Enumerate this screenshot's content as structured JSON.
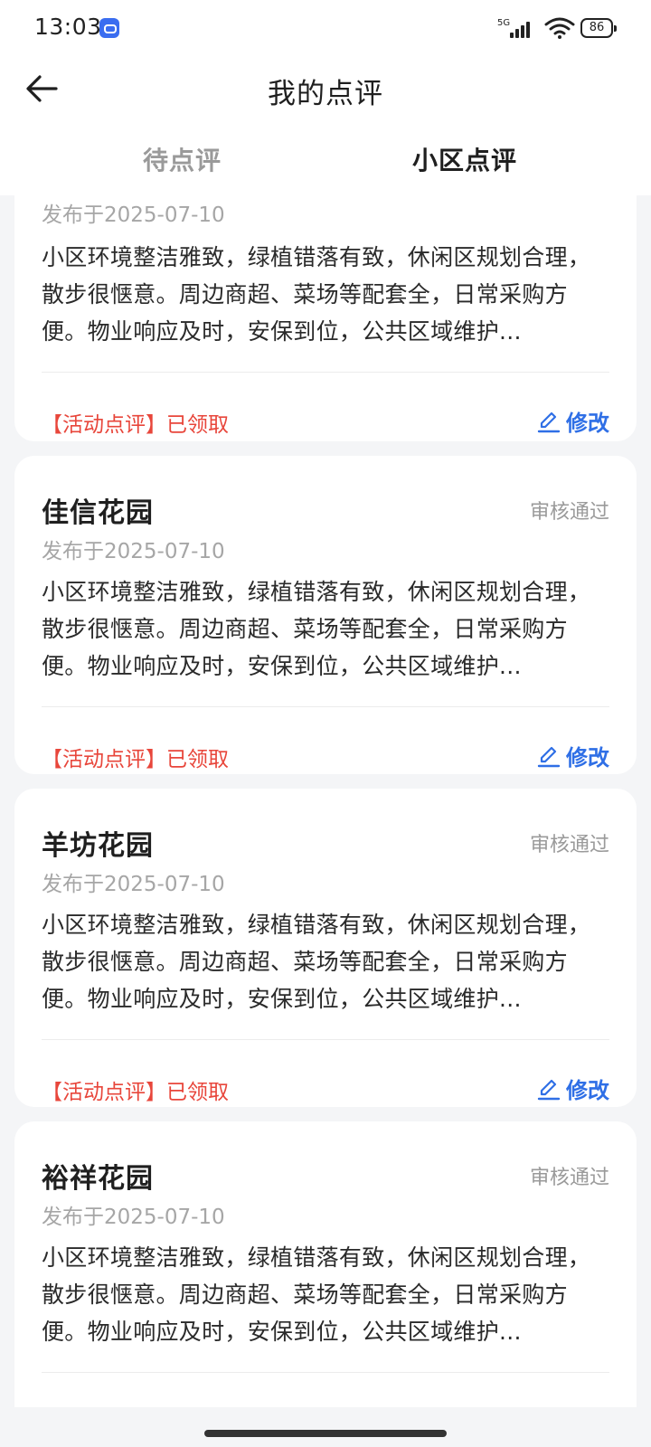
{
  "status_bar": {
    "time": "13:03",
    "network": "5G",
    "battery": "86"
  },
  "header": {
    "title": "我的点评",
    "back_icon": "arrow-left-icon"
  },
  "tabs": [
    {
      "label": "待点评",
      "active": false
    },
    {
      "label": "小区点评",
      "active": true
    }
  ],
  "colors": {
    "accent": "#2f6fe6",
    "badge": "#e8463b",
    "background": "#f4f5f7"
  },
  "reviews": [
    {
      "name": "",
      "status": "",
      "date": "发布于2025-07-10",
      "text": "小区环境整洁雅致，绿植错落有致，休闲区规划合理，散步很惬意。周边商超、菜场等配套全，日常采购方便。物业响应及时，安保到位，公共区域维护...",
      "badge": "【活动点评】已领取",
      "edit_label": "修改"
    },
    {
      "name": "佳信花园",
      "status": "审核通过",
      "date": "发布于2025-07-10",
      "text": "小区环境整洁雅致，绿植错落有致，休闲区规划合理，散步很惬意。周边商超、菜场等配套全，日常采购方便。物业响应及时，安保到位，公共区域维护...",
      "badge": "【活动点评】已领取",
      "edit_label": "修改"
    },
    {
      "name": "羊坊花园",
      "status": "审核通过",
      "date": "发布于2025-07-10",
      "text": "小区环境整洁雅致，绿植错落有致，休闲区规划合理，散步很惬意。周边商超、菜场等配套全，日常采购方便。物业响应及时，安保到位，公共区域维护...",
      "badge": "【活动点评】已领取",
      "edit_label": "修改"
    },
    {
      "name": "裕祥花园",
      "status": "审核通过",
      "date": "发布于2025-07-10",
      "text": "小区环境整洁雅致，绿植错落有致，休闲区规划合理，散步很惬意。周边商超、菜场等配套全，日常采购方便。物业响应及时，安保到位，公共区域维护...",
      "badge": "",
      "edit_label": ""
    }
  ]
}
